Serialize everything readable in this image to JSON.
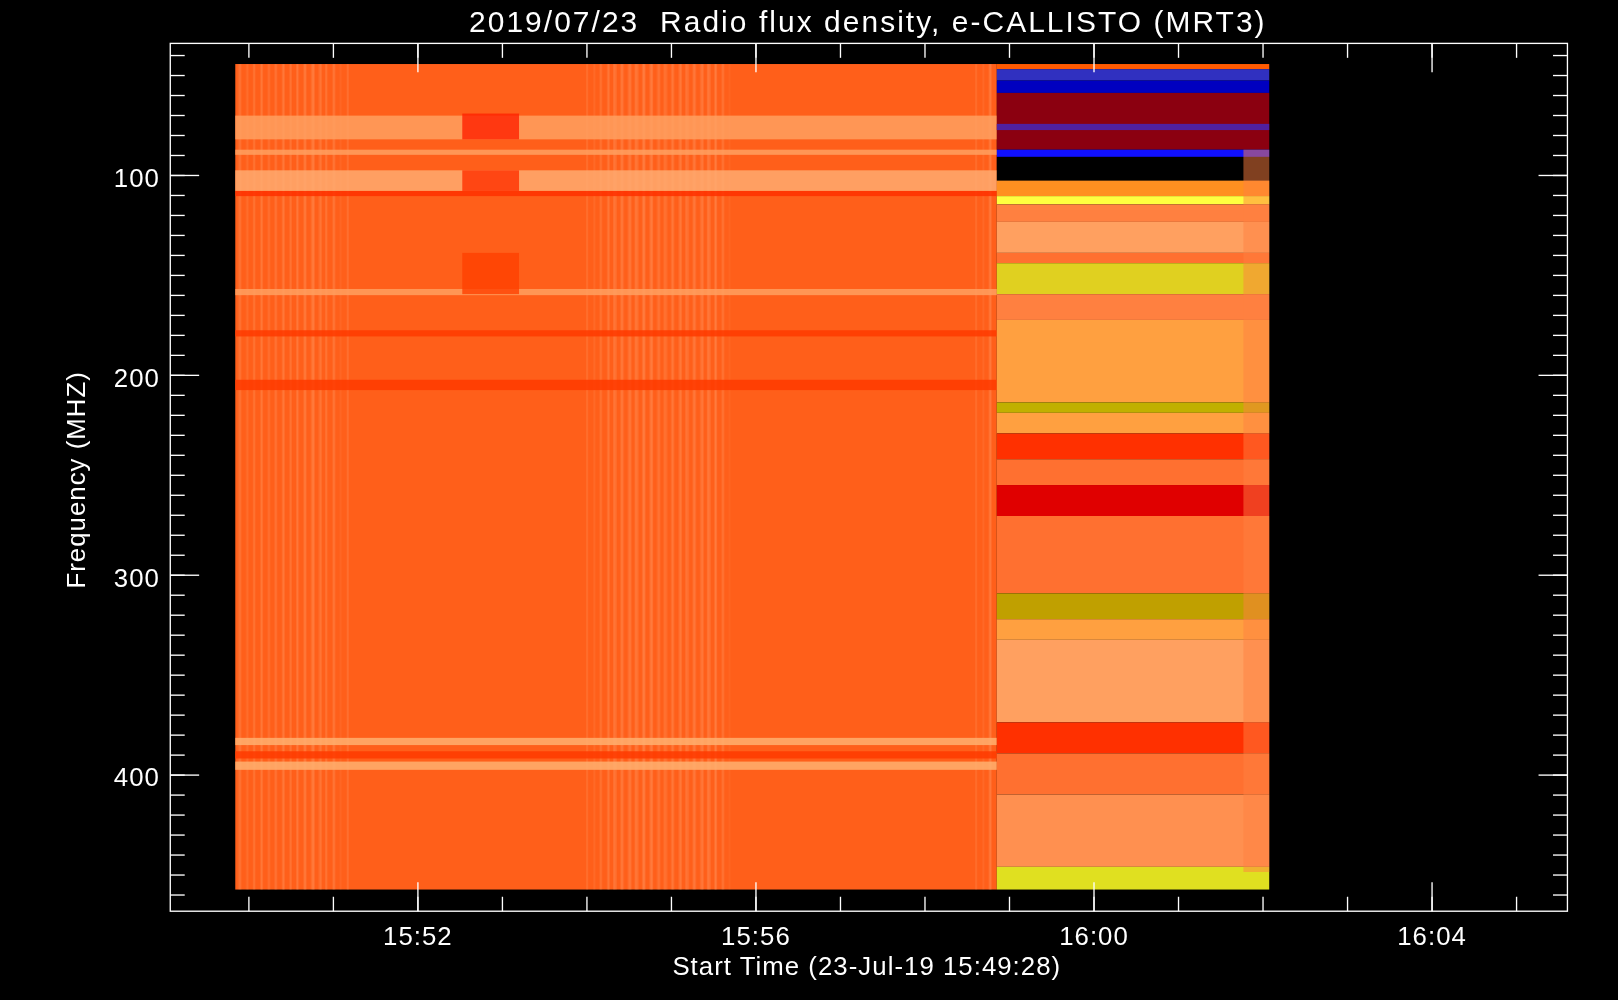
{
  "title": "2019/07/23  Radio flux density, e-CALLISTO (MRT3)",
  "y_axis": {
    "label": "Frequency (MHZ)",
    "ticks": [
      "100",
      "200",
      "300",
      "400"
    ]
  },
  "x_axis": {
    "label": "Start Time (23-Jul-19 15:49:28)",
    "ticks": [
      "15:52",
      "15:56",
      "16:00",
      "16:04"
    ]
  }
}
